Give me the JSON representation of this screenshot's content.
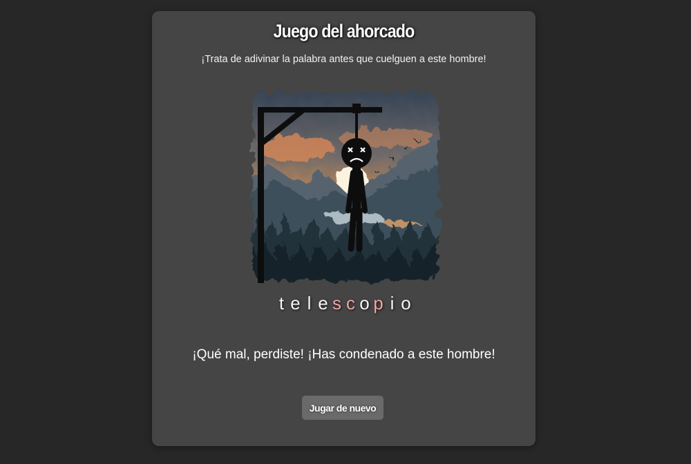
{
  "game": {
    "title": "Juego del ahorcado",
    "subtitle": "¡Trata de adivinar la palabra antes que cuelguen a este hombre!",
    "word_letters": [
      {
        "char": "t",
        "status": "revealed"
      },
      {
        "char": "e",
        "status": "revealed"
      },
      {
        "char": "l",
        "status": "revealed"
      },
      {
        "char": "e",
        "status": "revealed"
      },
      {
        "char": "s",
        "status": "missed"
      },
      {
        "char": "c",
        "status": "missed"
      },
      {
        "char": "o",
        "status": "revealed"
      },
      {
        "char": "p",
        "status": "missed"
      },
      {
        "char": "i",
        "status": "revealed"
      },
      {
        "char": "o",
        "status": "revealed"
      }
    ],
    "result_message": "¡Qué mal, perdiste! ¡Has condenado a este hombre!",
    "play_again_label": "Jugar de nuevo",
    "colors": {
      "background": "#272727",
      "card": "#454545",
      "revealed_letter": "#f4f4f4",
      "missed_letter": "#f0a3a3",
      "button": "#6a6a6a"
    },
    "scene_icon": "hanged-man-sunset-forest"
  }
}
